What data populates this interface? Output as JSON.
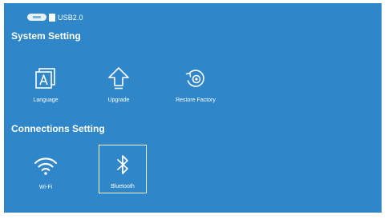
{
  "status_bar": {
    "usb_label": "USB2.0",
    "icons": [
      "battery-icon",
      "usb-drive-icon"
    ]
  },
  "system_setting": {
    "title": "System Setting",
    "items": [
      {
        "label": "Language",
        "icon": "language-icon"
      },
      {
        "label": "Upgrade",
        "icon": "upgrade-arrow-icon"
      },
      {
        "label": "Restore Factory",
        "icon": "restore-factory-icon"
      }
    ]
  },
  "connections_setting": {
    "title": "Connections Setting",
    "items": [
      {
        "label": "Wi-Fi",
        "icon": "wifi-icon"
      },
      {
        "label": "Bluetooth",
        "icon": "bluetooth-icon",
        "selected": true
      }
    ]
  },
  "colors": {
    "background": "#2f86c8",
    "foreground": "#ffffff"
  }
}
